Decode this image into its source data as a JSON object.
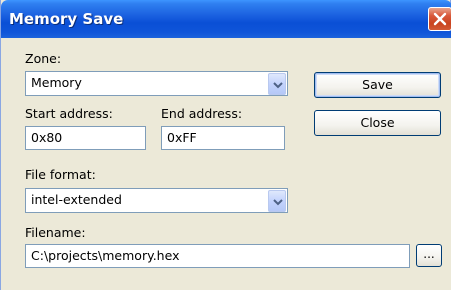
{
  "window": {
    "title": "Memory Save"
  },
  "zone": {
    "label": "Zone:",
    "value": "Memory"
  },
  "start_address": {
    "label": "Start address:",
    "value": "0x80"
  },
  "end_address": {
    "label": "End address:",
    "value": "0xFF"
  },
  "file_format": {
    "label": "File format:",
    "value": "intel-extended"
  },
  "filename": {
    "label": "Filename:",
    "value": "C:\\projects\\memory.hex",
    "browse_label": "..."
  },
  "buttons": {
    "save": "Save",
    "close": "Close"
  },
  "icons": {
    "close": "close-icon",
    "dropdown": "chevron-down-icon"
  },
  "colors": {
    "title_bar": "#0a4fd6",
    "close_button": "#d9583a",
    "dialog_bg": "#ece9d8",
    "field_border": "#7f9db9"
  }
}
